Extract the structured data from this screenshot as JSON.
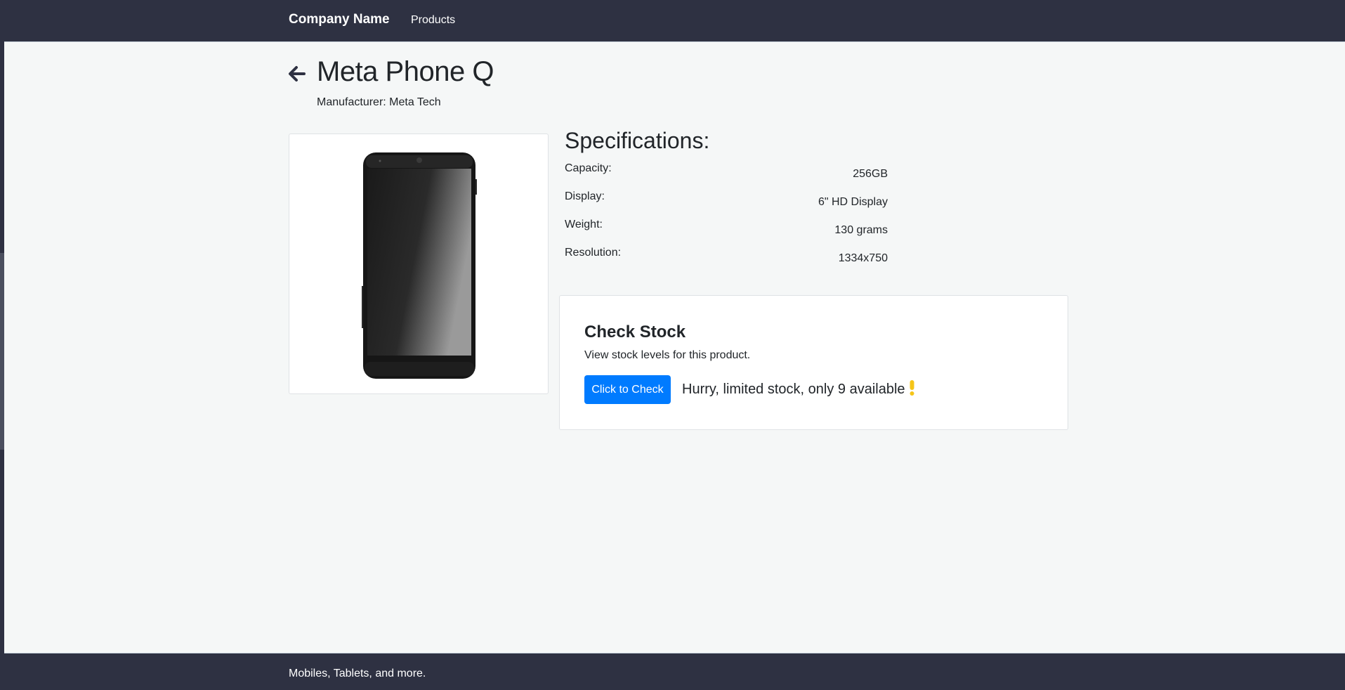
{
  "navbar": {
    "brand": "Company Name",
    "links": [
      {
        "label": "Products"
      }
    ]
  },
  "product": {
    "title": "Meta Phone Q",
    "manufacturer": "Manufacturer: Meta Tech",
    "image_icon": "phone-image"
  },
  "specifications": {
    "title": "Specifications:",
    "rows": [
      {
        "label": "Capacity:",
        "value": "256GB"
      },
      {
        "label": "Display:",
        "value": "6\" HD Display"
      },
      {
        "label": "Weight:",
        "value": "130 grams"
      },
      {
        "label": "Resolution:",
        "value": "1334x750"
      }
    ]
  },
  "stock": {
    "title": "Check Stock",
    "subtitle": "View stock levels for this product.",
    "button_label": "Click to Check",
    "message": "Hurry, limited stock, only 9 available",
    "message_icon": "exclamation-icon"
  },
  "footer": {
    "text": "Mobiles, Tablets, and more."
  },
  "colors": {
    "navbar_bg": "#2e3142",
    "page_bg": "#f5f7f7",
    "button_bg": "#007bff",
    "warning": "#f5c518"
  }
}
